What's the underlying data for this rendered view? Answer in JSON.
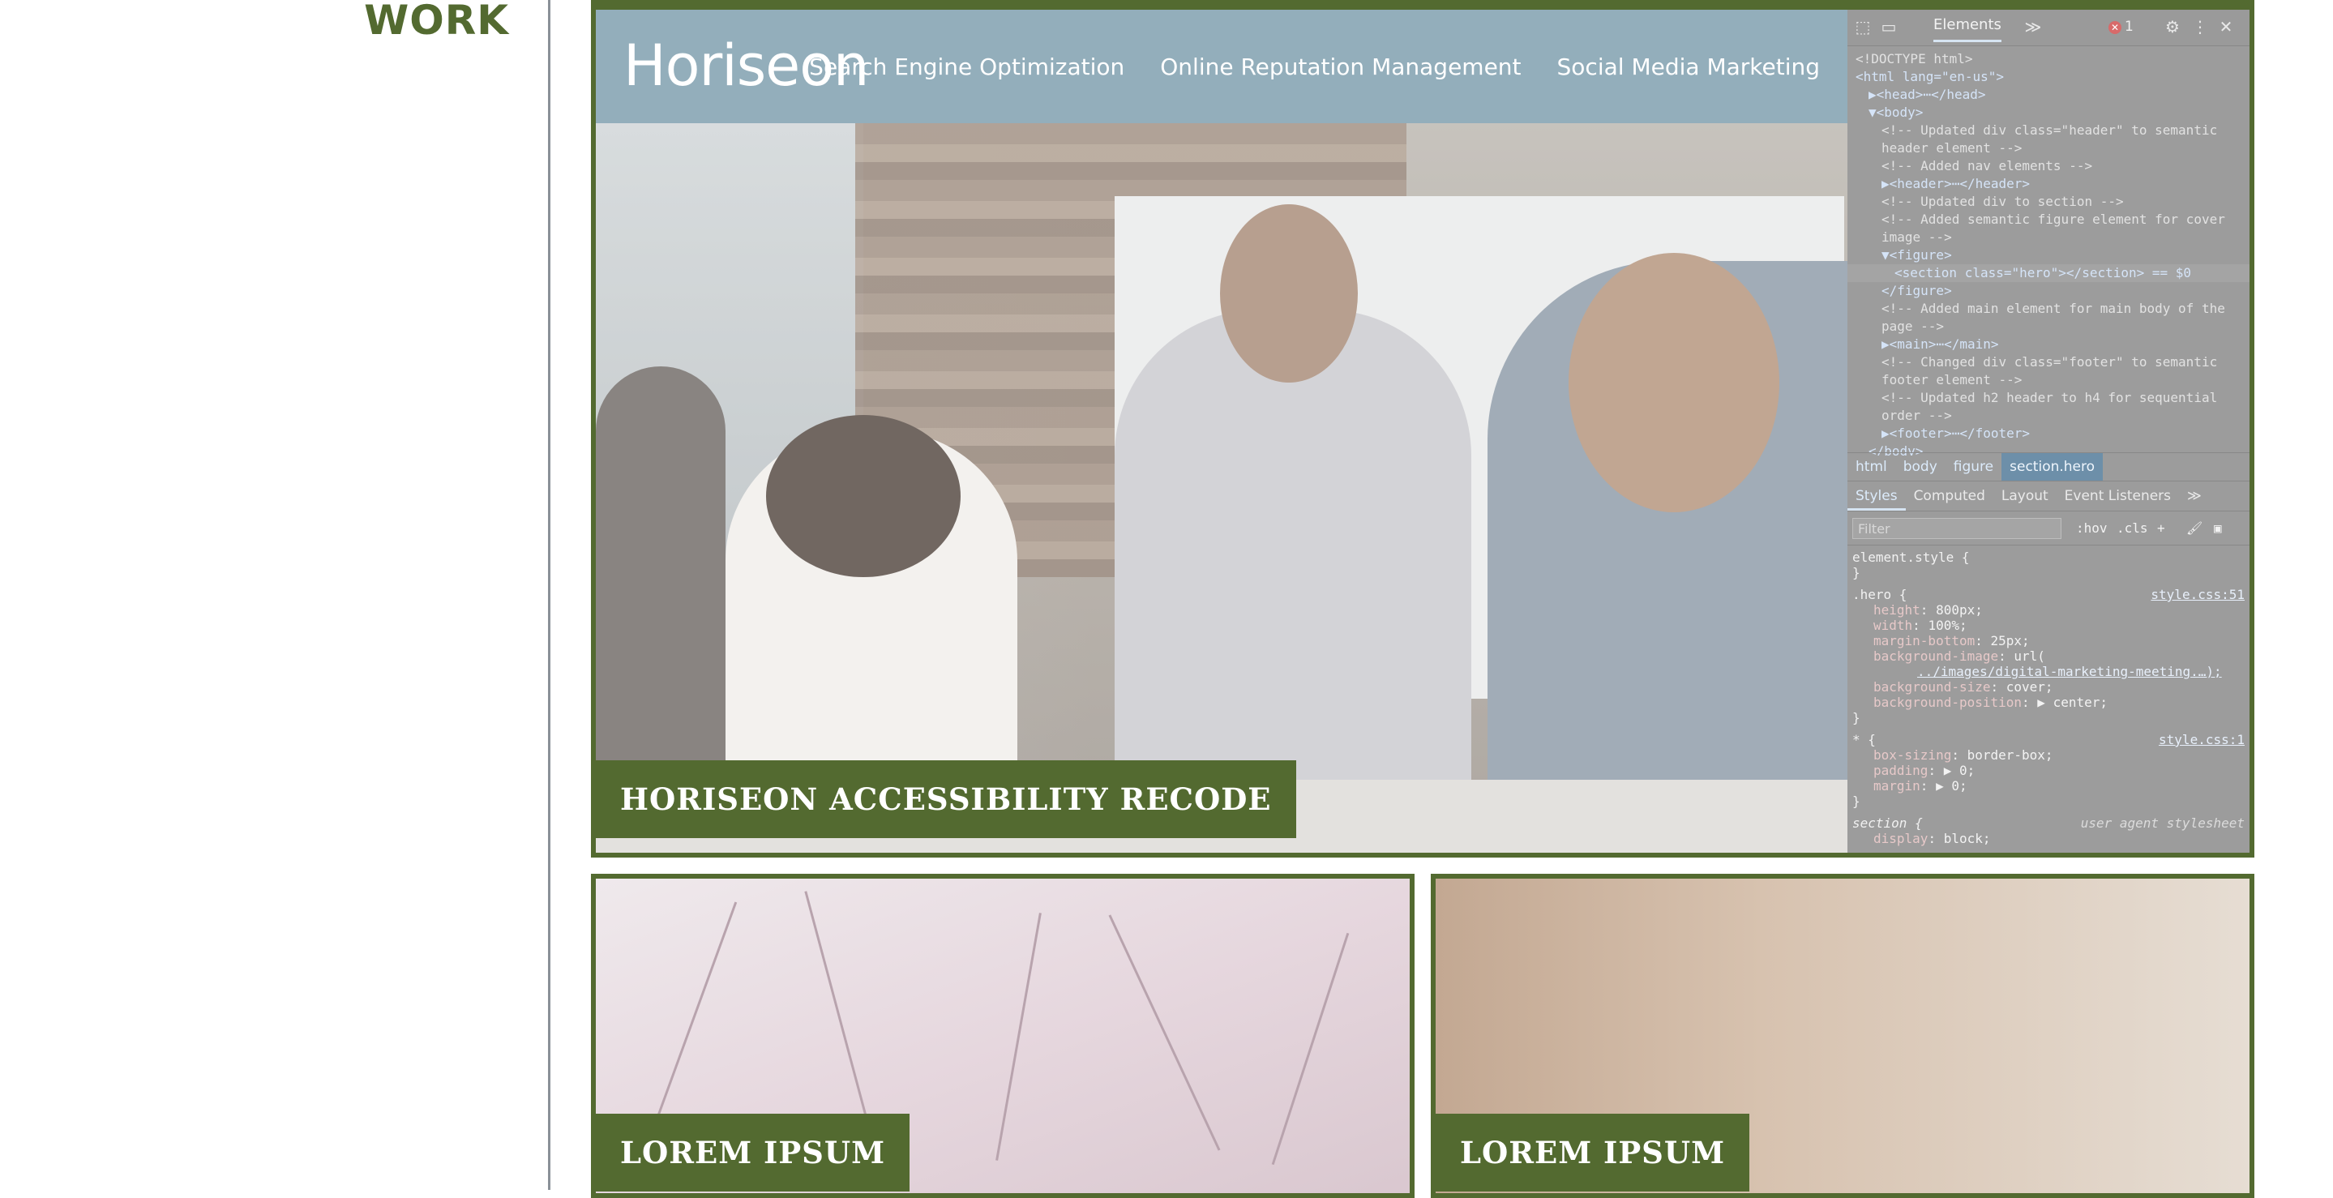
{
  "left": {
    "heading": "WORK"
  },
  "site": {
    "brand": "Horiseon",
    "nav": [
      "Search Engine Optimization",
      "Online Reputation Management",
      "Social Media Marketing"
    ],
    "hero_title": "HORISEON ACCESSIBILITY RECODE",
    "cards": [
      {
        "title": "LOREM IPSUM"
      },
      {
        "title": "LOREM IPSUM"
      }
    ]
  },
  "devtools": {
    "tab": "Elements",
    "error_count": "1",
    "dom_lines": [
      {
        "text": "<!DOCTYPE html>",
        "indent": 0,
        "kind": "comment"
      },
      {
        "text": "<html lang=\"en-us\">",
        "indent": 0,
        "kind": "tag"
      },
      {
        "text": "▶<head>⋯</head>",
        "indent": 1,
        "kind": "tag"
      },
      {
        "text": "▼<body>",
        "indent": 1,
        "kind": "tag"
      },
      {
        "text": "<!-- Updated div class=\"header\" to semantic",
        "indent": 2,
        "kind": "comment"
      },
      {
        "text": "header element -->",
        "indent": 2,
        "kind": "comment"
      },
      {
        "text": "<!-- Added nav elements -->",
        "indent": 2,
        "kind": "comment"
      },
      {
        "text": "▶<header>⋯</header>",
        "indent": 2,
        "kind": "tag"
      },
      {
        "text": "<!-- Updated div to section -->",
        "indent": 2,
        "kind": "comment"
      },
      {
        "text": "<!-- Added semantic figure element for cover",
        "indent": 2,
        "kind": "comment"
      },
      {
        "text": "image -->",
        "indent": 2,
        "kind": "comment"
      },
      {
        "text": "▼<figure>",
        "indent": 2,
        "kind": "tag"
      },
      {
        "text": "<section class=\"hero\"></section> == $0",
        "indent": 3,
        "kind": "tag",
        "selected": true
      },
      {
        "text": "</figure>",
        "indent": 2,
        "kind": "tag"
      },
      {
        "text": "<!-- Added main element for main body of the",
        "indent": 2,
        "kind": "comment"
      },
      {
        "text": "page -->",
        "indent": 2,
        "kind": "comment"
      },
      {
        "text": "▶<main>⋯</main>",
        "indent": 2,
        "kind": "tag"
      },
      {
        "text": "<!-- Changed div class=\"footer\" to semantic",
        "indent": 2,
        "kind": "comment"
      },
      {
        "text": "footer element -->",
        "indent": 2,
        "kind": "comment"
      },
      {
        "text": "<!-- Updated h2 header to h4 for sequential",
        "indent": 2,
        "kind": "comment"
      },
      {
        "text": "order -->",
        "indent": 2,
        "kind": "comment"
      },
      {
        "text": "▶<footer>⋯</footer>",
        "indent": 2,
        "kind": "tag"
      },
      {
        "text": "</body>",
        "indent": 1,
        "kind": "tag"
      }
    ],
    "breadcrumbs": [
      "html",
      "body",
      "figure",
      "section.hero"
    ],
    "subtabs": [
      "Styles",
      "Computed",
      "Layout",
      "Event Listeners",
      "≫"
    ],
    "filter_placeholder": "Filter",
    "filter_buttons": [
      ":hov",
      ".cls",
      "+"
    ],
    "styles": {
      "element_style_open": "element.style {",
      "close": "}",
      "hero_selector": ".hero {",
      "hero_source": "style.css:51",
      "hero_props": [
        {
          "prop": "height",
          "val": "800px;"
        },
        {
          "prop": "width",
          "val": "100%;"
        },
        {
          "prop": "margin-bottom",
          "val": "25px;"
        },
        {
          "prop": "background-image",
          "val": "url("
        },
        {
          "prop": "",
          "val": "../images/digital-marketing-meeting.…);"
        },
        {
          "prop": "background-size",
          "val": "cover;"
        },
        {
          "prop": "background-position",
          "val": "▶ center;"
        }
      ],
      "star_selector": "* {",
      "star_source": "style.css:1",
      "star_props": [
        {
          "prop": "box-sizing",
          "val": "border-box;"
        },
        {
          "prop": "padding",
          "val": "▶ 0;"
        },
        {
          "prop": "margin",
          "val": "▶ 0;"
        }
      ],
      "section_selector": "section {",
      "section_source": "user agent stylesheet",
      "section_props": [
        {
          "prop": "display",
          "val": "block;"
        }
      ]
    }
  },
  "colors": {
    "accent_green": "#536a30",
    "header_blue": "#93aebb",
    "devtools_bg": "#9c9c9c"
  }
}
